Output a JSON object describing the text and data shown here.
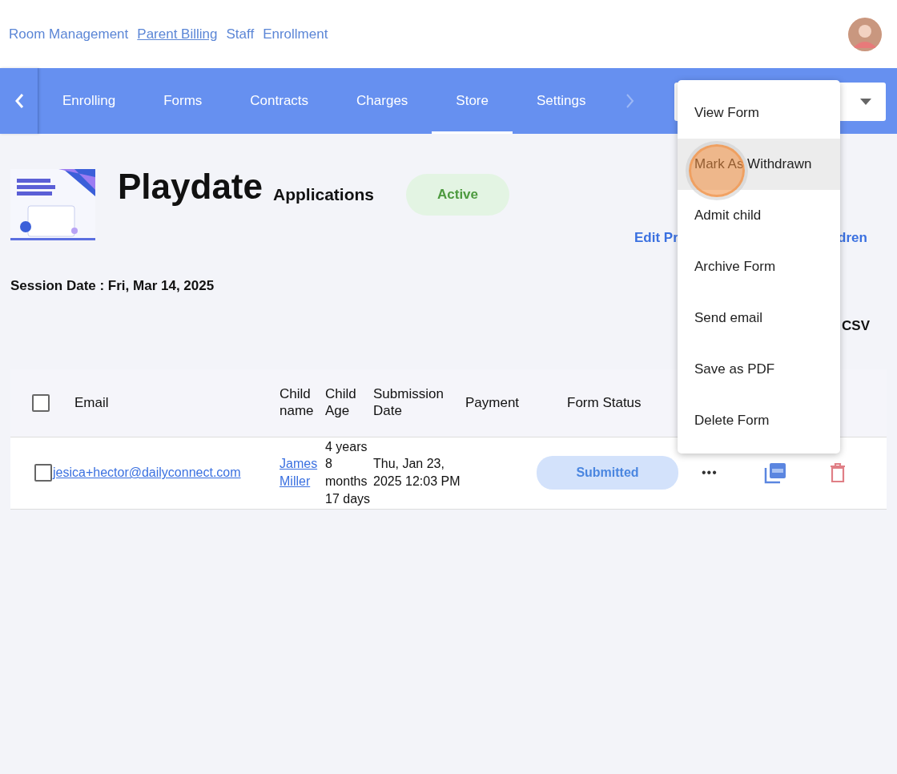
{
  "top_links": [
    {
      "label": "Room Management",
      "selected": false
    },
    {
      "label": "Parent Billing",
      "selected": true
    },
    {
      "label": "Staff",
      "selected": false
    },
    {
      "label": "Enrollment",
      "selected": false
    }
  ],
  "tabs": [
    {
      "label": "Enrolling",
      "selected": false
    },
    {
      "label": "Forms",
      "selected": false
    },
    {
      "label": "Contracts",
      "selected": false
    },
    {
      "label": "Charges",
      "selected": false
    },
    {
      "label": "Store",
      "selected": true
    },
    {
      "label": "Settings",
      "selected": false
    }
  ],
  "program": {
    "title": "Playdate",
    "subtitle": "Applications",
    "status": "Active",
    "link_left": "Edit Pr",
    "link_right": "dren",
    "session_date": "Session Date : Fri, Mar 14, 2025",
    "export": "CSV"
  },
  "table": {
    "select_all_checked": false,
    "columns": [
      "Email",
      "Child name",
      "Child Age",
      "Submission Date",
      "Payment",
      "Form Status"
    ],
    "rows": [
      {
        "checked": false,
        "email": "jesica+hector@dailyconnect.com",
        "child_name": "James Miller",
        "child_age": "4 years 8 months 17 days",
        "submission_date": "Thu, Jan 23, 2025 12:03 PM",
        "payment_status": "",
        "form_status": "Submitted",
        "more": "•••"
      }
    ]
  },
  "menu": {
    "items": [
      {
        "label": "View Form",
        "hovered": false
      },
      {
        "label": "Mark As Withdrawn",
        "hovered": true
      },
      {
        "label": "Admit child",
        "hovered": false
      },
      {
        "label": "Archive Form",
        "hovered": false
      },
      {
        "label": "Send email",
        "hovered": false
      },
      {
        "label": "Save as PDF",
        "hovered": false
      },
      {
        "label": "Delete Form",
        "hovered": false
      }
    ]
  }
}
